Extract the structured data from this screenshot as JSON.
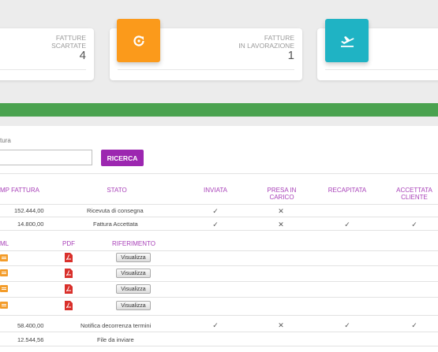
{
  "cards": [
    {
      "label": "Fatture\nScartate",
      "count": "4"
    },
    {
      "label": "Fatture\nin lavorazione",
      "count": "1"
    }
  ],
  "tiles": [
    {
      "icon": "refresh-icon",
      "color": "#fb9a1b"
    },
    {
      "icon": "plane-takeoff-icon",
      "color": "#1fb3c4"
    }
  ],
  "accent_color": "#9c27b0",
  "search": {
    "label": "tura",
    "button": "RICERCA"
  },
  "table": {
    "headers": {
      "imp": "MP FATTURA",
      "stato": "STATO",
      "inviata": "INVIATA",
      "presa": "PRESA IN CARICO",
      "recapitata": "RECAPITATA",
      "accettata": "ACCETTATA CLIENTE"
    },
    "rows": [
      {
        "amount": "152.444,00",
        "stato": "Ricevuta di consegna",
        "inviata": "✓",
        "presa": "✕",
        "recapitata": "",
        "accettata": ""
      },
      {
        "amount": "14.800,00",
        "stato": "Fattura Accettata",
        "inviata": "✓",
        "presa": "✕",
        "recapitata": "✓",
        "accettata": "✓"
      }
    ],
    "sub_headers": {
      "xml": "ML",
      "pdf": "PDF",
      "riferimento": "RIFERIMENTO"
    },
    "attachments": [
      {
        "button": "Visualizza"
      },
      {
        "button": "Visualizza"
      },
      {
        "button": "Visualizza"
      },
      {
        "button": "Visualizza"
      }
    ],
    "rows2": [
      {
        "amount": "58.400,00",
        "stato": "Notifica decorrenza termini",
        "inviata": "✓",
        "presa": "✕",
        "recapitata": "✓",
        "accettata": "✓"
      },
      {
        "amount": "12.544,56",
        "stato": "File da inviare",
        "inviata": "",
        "presa": "",
        "recapitata": "",
        "accettata": ""
      }
    ]
  }
}
